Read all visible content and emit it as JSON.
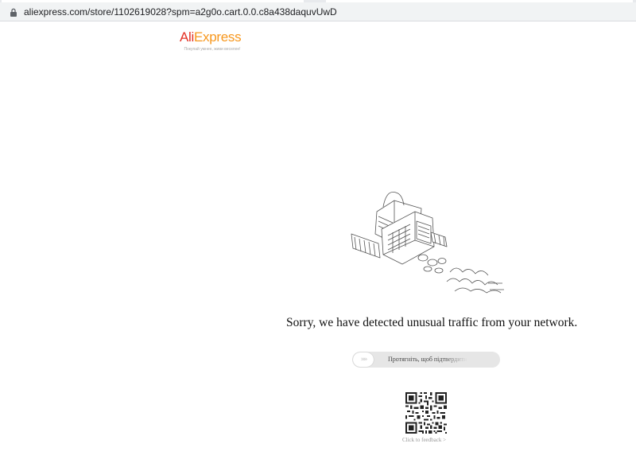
{
  "browser": {
    "url": "aliexpress.com/store/1102619028?spm=a2g0o.cart.0.0.c8a438daquvUwD"
  },
  "logo": {
    "part1": "Ali",
    "part2": "Express",
    "tagline": "Покупай умнее, живи веселее!"
  },
  "captcha": {
    "message": "Sorry, we have detected unusual traffic from your network.",
    "slider_text": "Протягніть, щоб підтвердити",
    "slider_progress": 0,
    "feedback_link": "Click to feedback >"
  },
  "colors": {
    "logo_red": "#e43225",
    "logo_orange": "#f7971d",
    "slider_track": "#e6e6e6"
  },
  "icons": [
    "lock-icon",
    "slider-arrows-icon",
    "qr-code-icon"
  ]
}
